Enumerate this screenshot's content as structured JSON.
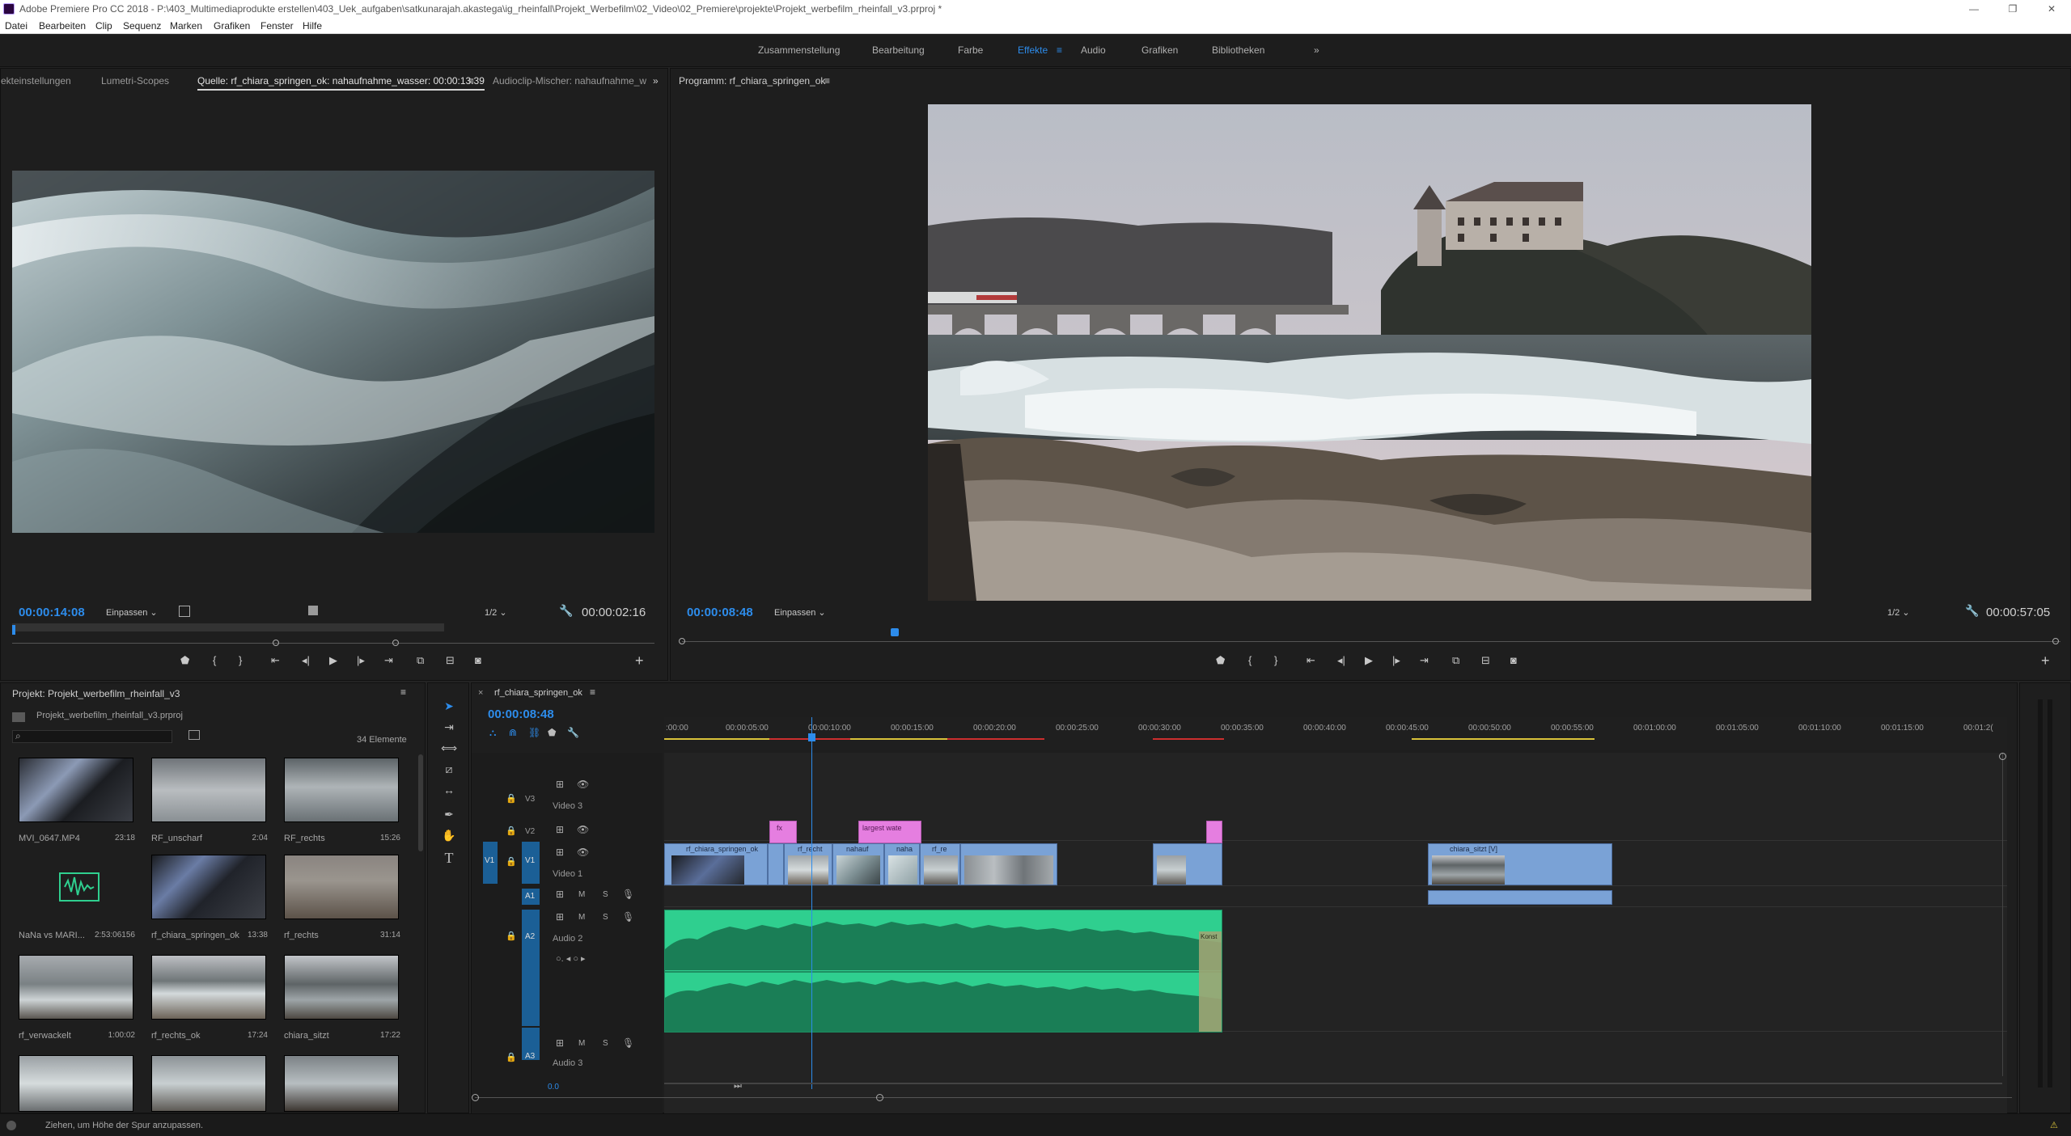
{
  "window": {
    "title": "Adobe Premiere Pro CC 2018 - P:\\403_Multimediaprodukte erstellen\\403_Uek_aufgaben\\satkunarajah.akastega\\ig_rheinfall\\Projekt_Werbefilm\\02_Video\\02_Premiere\\projekte\\Projekt_werbefilm_rheinfall_v3.prproj *",
    "minimize": "—",
    "maximize": "❐",
    "close": "✕"
  },
  "menu": [
    "Datei",
    "Bearbeiten",
    "Clip",
    "Sequenz",
    "Marken",
    "Grafiken",
    "Fenster",
    "Hilfe"
  ],
  "workspaces": {
    "items": [
      "Zusammenstellung",
      "Bearbeitung",
      "Farbe",
      "Effekte",
      "Audio",
      "Grafiken",
      "Bibliotheken"
    ],
    "active": "Effekte",
    "more": "»"
  },
  "source_panel": {
    "tabs": [
      "ekteinstellungen",
      "Lumetri-Scopes",
      "Quelle: rf_chiara_springen_ok: nahaufnahme_wasser: 00:00:13:39",
      "Audioclip-Mischer: nahaufnahme_w"
    ],
    "timecode": "00:00:14:08",
    "fit": "Einpassen",
    "resolution": "1/2",
    "duration": "00:00:02:16"
  },
  "program_panel": {
    "tab": "Programm: rf_chiara_springen_ok",
    "timecode": "00:00:08:48",
    "fit": "Einpassen",
    "resolution": "1/2",
    "duration": "00:00:57:05"
  },
  "project_panel": {
    "title": "Projekt: Projekt_werbefilm_rheinfall_v3",
    "file": "Projekt_werbefilm_rheinfall_v3.prproj",
    "count": "34 Elemente",
    "items": [
      {
        "name": "MVI_0647.MP4",
        "dur": "23:18"
      },
      {
        "name": "RF_unscharf",
        "dur": "2:04"
      },
      {
        "name": "RF_rechts",
        "dur": "15:26"
      },
      {
        "name": "NaNa vs MARI...",
        "dur": "2:53:06156"
      },
      {
        "name": "rf_chiara_springen_ok",
        "dur": "13:38"
      },
      {
        "name": "rf_rechts",
        "dur": "31:14"
      },
      {
        "name": "rf_verwackelt",
        "dur": "1:00:02"
      },
      {
        "name": "rf_rechts_ok",
        "dur": "17:24"
      },
      {
        "name": "chiara_sitzt",
        "dur": "17:22"
      }
    ]
  },
  "timeline": {
    "tab": "rf_chiara_springen_ok",
    "timecode": "00:00:08:48",
    "ruler": ":00:00",
    "ruler_labels": [
      ":00:00",
      "00:00:05:00",
      "00:00:10:00",
      "00:00:15:00",
      "00:00:20:00",
      "00:00:25:00",
      "00:00:30:00",
      "00:00:35:00",
      "00:00:40:00",
      "00:00:45:00",
      "00:00:50:00",
      "00:00:55:00",
      "00:01:00:00",
      "00:01:05:00",
      "00:01:10:00",
      "00:01:15:00",
      "00:01:2("
    ],
    "tracks": {
      "v3": "V3",
      "v3_name": "Video 3",
      "v2": "V2",
      "v1": "V1",
      "v1_name": "Video 1",
      "a1": "A1",
      "a2": "A2",
      "a2_name": "Audio 2",
      "a3": "A3",
      "a3_name": "Audio 3"
    },
    "clips": {
      "v1_first": "rf_chiara_springen_ok",
      "v1_b": "rf_recht",
      "v1_c": "nahauf",
      "v1_d": "naha",
      "v1_e": "rf_re",
      "v2_title": "largest wate",
      "v1_late": "chiara_sitzt [V]",
      "konst": "Konst"
    },
    "zoom": "0.0",
    "fx": "fx"
  },
  "status": "Ziehen, um Höhe der Spur anzupassen."
}
